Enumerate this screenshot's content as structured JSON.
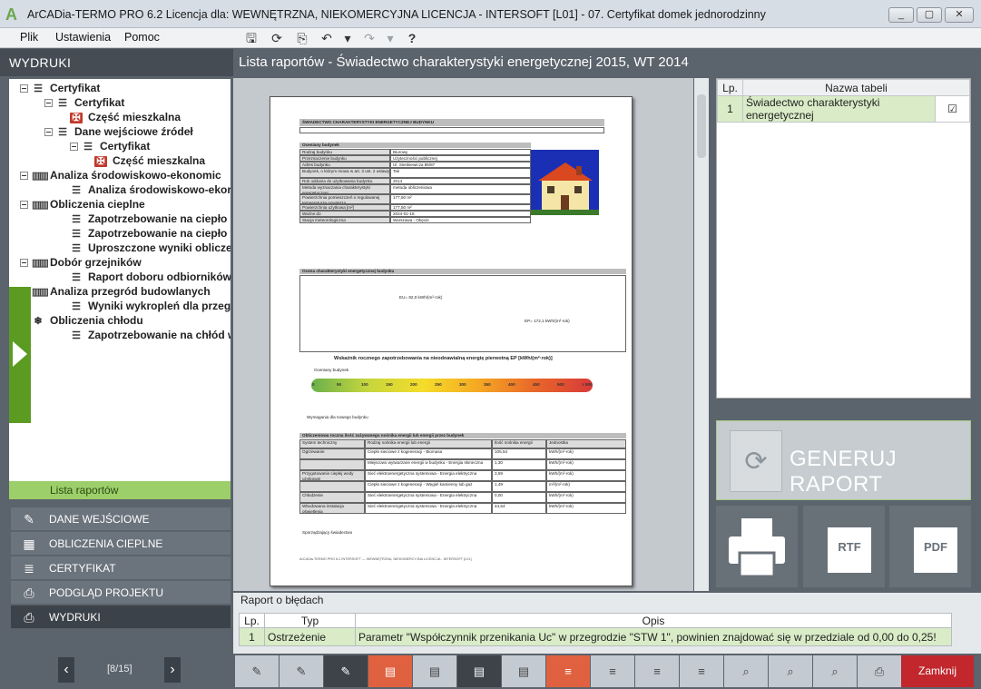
{
  "window": {
    "title": "ArCADia-TERMO PRO 6.2 Licencja dla: WEWNĘTRZNA, NIEKOMERCYJNA LICENCJA - INTERSOFT [L01] - 07. Certyfikat domek jednorodzinny",
    "logo": "A",
    "controls": [
      "_",
      "▢",
      "✕"
    ]
  },
  "menu": {
    "items": [
      "Plik",
      "Ustawienia",
      "Pomoc"
    ]
  },
  "toolbar": {
    "icons": [
      "save-icon",
      "refresh-icon",
      "preview-icon",
      "undo-icon",
      "undo-dropdown-icon",
      "redo-icon",
      "redo-dropdown-icon",
      "help-icon"
    ]
  },
  "left": {
    "header": "WYDRUKI",
    "tree": [
      {
        "label": "Certyfikat",
        "bold": true,
        "icon": "doc-icon"
      },
      {
        "label": "Certyfikat",
        "bold": true,
        "icon": "doc-icon"
      },
      {
        "label": "Część mieszkalna",
        "bold": false,
        "icon": "pl-icon"
      },
      {
        "label": "Dane wejściowe źródeł",
        "bold": false,
        "icon": "doc-icon"
      },
      {
        "label": "Certyfikat",
        "bold": false,
        "icon": "doc-icon"
      },
      {
        "label": "Część mieszkalna",
        "bold": false,
        "icon": "pl-icon"
      },
      {
        "label": "Analiza środowiskowo-ekonomic",
        "bold": false,
        "icon": "chart-icon"
      },
      {
        "label": "Analiza środowiskowo-ekor",
        "bold": false,
        "icon": "doc-icon"
      },
      {
        "label": "Obliczenia cieplne",
        "bold": false,
        "icon": "chart-icon"
      },
      {
        "label": "Zapotrzebowanie na ciepło v",
        "bold": false,
        "icon": "doc-icon"
      },
      {
        "label": "Zapotrzebowanie na ciepło v",
        "bold": false,
        "icon": "doc-icon"
      },
      {
        "label": "Uproszczone wyniki obliczer",
        "bold": false,
        "icon": "doc-icon"
      },
      {
        "label": "Dobór grzejników",
        "bold": false,
        "icon": "chart-icon"
      },
      {
        "label": "Raport doboru odbiorników",
        "bold": false,
        "icon": "doc-icon"
      },
      {
        "label": "Analiza przegród budowlanych",
        "bold": false,
        "icon": "chart-icon"
      },
      {
        "label": "Wyniki wykropleń dla przegr",
        "bold": false,
        "icon": "doc-icon"
      },
      {
        "label": "Obliczenia chłodu",
        "bold": false,
        "icon": "snowflake-icon"
      },
      {
        "label": "Zapotrzebowanie na chłód w",
        "bold": false,
        "icon": "doc-icon"
      }
    ],
    "reports_bar": "Lista raportów",
    "nav": [
      {
        "label": "DANE WEJŚCIOWE",
        "icon": "input-icon"
      },
      {
        "label": "OBLICZENIA CIEPLNE",
        "icon": "calc-icon"
      },
      {
        "label": "CERTYFIKAT",
        "icon": "certificate-icon"
      },
      {
        "label": "PODGLĄD PROJEKTU",
        "icon": "preview-icon"
      },
      {
        "label": "WYDRUKI",
        "icon": "printer-icon"
      }
    ],
    "pager": {
      "prev": "‹",
      "text": "[8/15]",
      "next": "›"
    }
  },
  "center": {
    "header": "Lista raportów - Świadectwo charakterystyki energetycznej 2015, WT 2014",
    "doc": {
      "title": "ŚWIADECTWO CHARAKTERYSTYKI ENERGETYCZNEJ BUDYNKU",
      "number_label": "Numer świadectwa",
      "section1": "Oceniany budynek",
      "rows": [
        {
          "k": "Rodzaj budynku",
          "v": "Biurowy"
        },
        {
          "k": "Przeznaczenie budynku",
          "v": "Użyteczności publicznej"
        },
        {
          "k": "Adres budynku",
          "v": "Ul. Sienkiewicza 85/87"
        },
        {
          "k": "Budynek, o którym mowa w art. 3 ust. 2 ustawy",
          "v": "Tak"
        },
        {
          "k": "Rok oddania do użytkowania budynku",
          "v": "2014"
        },
        {
          "k": "Metoda wyznaczania charakterystyki energetycznej",
          "v": "metoda obliczeniowa"
        },
        {
          "k": "Powierzchnia pomieszczeń o regulowanej temperaturze powietrza",
          "v": "177,50 m²"
        },
        {
          "k": "Powierzchnia użytkowa [m²]",
          "v": "177,50 m²"
        },
        {
          "k": "Ważne do",
          "v": "2024-01-16"
        },
        {
          "k": "Stacja meteorologiczna",
          "v": "Warszawa - Okęcie"
        }
      ],
      "section2": "Ocena charakterystyki energetycznej budynku",
      "ep_label": "EP= 172,1 kWh/(m²·rok)",
      "eu_label": "EU= 82,0 kWh/(m²·rok)",
      "scale_title": "Wskaźnik rocznego zapotrzebowania na nieodnawialną energię pierwotną EP [kWh/(m²·rok)]",
      "scale_marker_top": "Oceniany budynek",
      "scale_marker_bottom": "Wymagania dla nowego budynku",
      "scale_ticks": [
        "0",
        "50",
        "100",
        "150",
        "200",
        "250",
        "300",
        "350",
        "400",
        "450",
        "500",
        "> 500"
      ],
      "section3": "Obliczeniowa roczna ilość zużywanego nośnika energii lub energii przez budynek",
      "table3": [
        {
          "sys": "System techniczny",
          "nos": "Rodzaj nośnika energii lub energii",
          "val": "Ilość nośnika energii",
          "unit": "Jednostka"
        },
        {
          "sys": "Ogrzewanie",
          "nos": "Ciepło sieciowe z kogeneracji - Biomasa",
          "val": "105,54",
          "unit": "kWh/(m²·rok)"
        },
        {
          "sys": "",
          "nos": "Miejscowo wytwarzane energii w budynku - Energia słoneczna",
          "val": "1,30",
          "unit": "kWh/(m²·rok)"
        },
        {
          "sys": "Przygotowanie ciepłej wody użytkowej",
          "nos": "Sieć elektroenergetyczna systemowa - Energia elektryczna",
          "val": "3,59",
          "unit": "kWh/(m²·rok)"
        },
        {
          "sys": "",
          "nos": "Ciepło sieciowe z kogeneracji - Węgiel kamienny lub gaz",
          "val": "1,49",
          "unit": "m³/(m²·rok)"
        },
        {
          "sys": "Chłodzenie",
          "nos": "Sieć elektroenergetyczna systemowa - Energia elektryczna",
          "val": "0,00",
          "unit": "kWh/(m²·rok)"
        },
        {
          "sys": "Wbudowana instalacja oświetlenia",
          "nos": "Sieć elektroenergetyczna systemowa - Energia elektryczna",
          "val": "44,64",
          "unit": "kWh/(m²·rok)"
        }
      ],
      "footer": "Sporządzający świadectwo",
      "footer2": "ArCADia-TERMO PRO 6.2 INTERSOFT — WEWNĘTRZNA, NIEKOMERCYJNA LICENCJA - INTERSOFT [L01]"
    },
    "zoom_icons": [
      "zoom-in-icon",
      "zoom-out-icon",
      "fit-page-icon"
    ]
  },
  "right": {
    "table": {
      "headers": [
        "Lp.",
        "Nazwa tabeli"
      ],
      "rows": [
        {
          "lp": "1",
          "name": "Świadectwo charakterystyki energetycznej",
          "checked": true
        }
      ]
    },
    "generate_label": "GENERUJ RAPORT",
    "print_icon": "printer-icon",
    "rtf_label": "RTF",
    "pdf_label": "PDF"
  },
  "errors": {
    "header": "Raport o błędach",
    "columns": [
      "Lp.",
      "Typ",
      "Opis"
    ],
    "rows": [
      {
        "lp": "1",
        "typ": "Ostrzeżenie",
        "opis": "Parametr \"Współczynnik przenikania Uc\" w przegrodzie \"STW 1\", powinien znajdować się w przedziale od 0,00 do 0,25!"
      }
    ]
  },
  "bottom": {
    "buttons": [
      "doc-edit-icon",
      "doc-edit-icon",
      "doc-edit-icon",
      "report-icon",
      "report-icon",
      "report-icon",
      "report-icon",
      "list-icon",
      "list-icon",
      "list-icon",
      "list-icon",
      "search-doc-icon",
      "search-doc-icon",
      "search-doc-icon",
      "printer-icon"
    ],
    "close_label": "Zamknij"
  }
}
